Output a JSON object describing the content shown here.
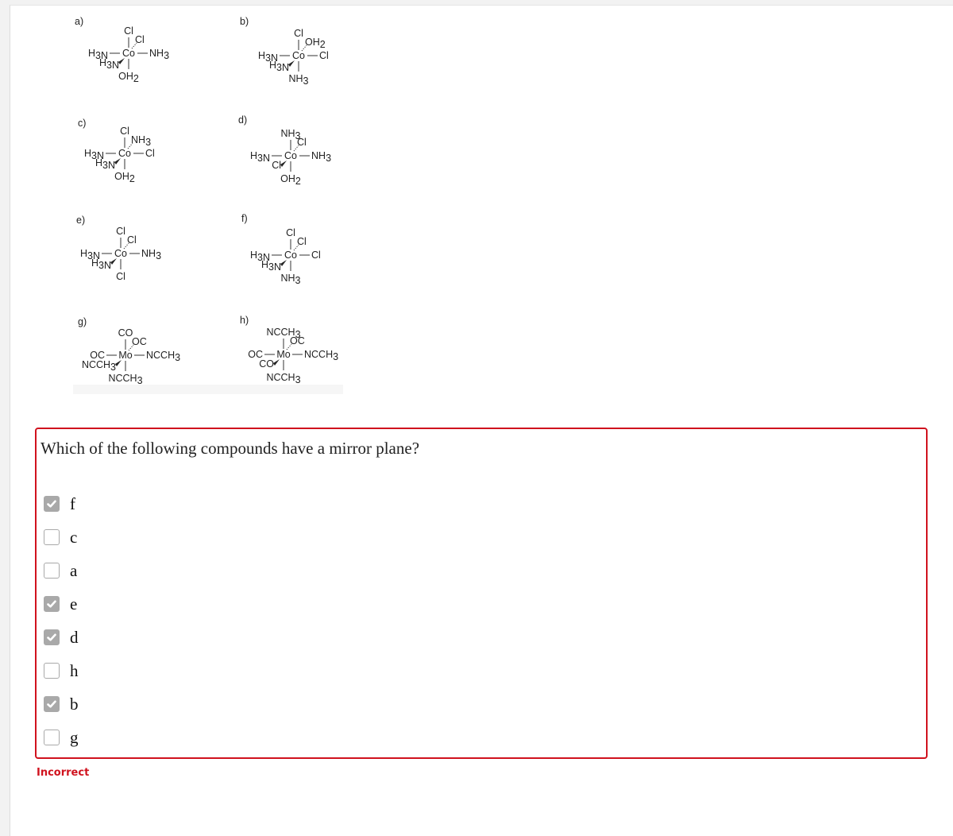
{
  "structures": [
    {
      "id": "a",
      "label": "a)",
      "metal": "Co",
      "top": "Cl",
      "bottom": "OH2",
      "left": "H3N",
      "right": "NH3",
      "back": "Cl",
      "front": "H3N"
    },
    {
      "id": "b",
      "label": "b)",
      "metal": "Co",
      "top": "Cl",
      "bottom": "NH3",
      "left": "H3N",
      "right": "Cl",
      "back": "OH2",
      "front": "H3N"
    },
    {
      "id": "c",
      "label": "c)",
      "metal": "Co",
      "top": "Cl",
      "bottom": "OH2",
      "left": "H3N",
      "right": "Cl",
      "back": "NH3",
      "front": "H3N"
    },
    {
      "id": "d",
      "label": "d)",
      "metal": "Co",
      "top": "NH3",
      "bottom": "OH2",
      "left": "H3N",
      "right": "NH3",
      "back": "Cl",
      "front": "Cl"
    },
    {
      "id": "e",
      "label": "e)",
      "metal": "Co",
      "top": "Cl",
      "bottom": "Cl",
      "left": "H3N",
      "right": "NH3",
      "back": "Cl",
      "front": "H3N"
    },
    {
      "id": "f",
      "label": "f)",
      "metal": "Co",
      "top": "Cl",
      "bottom": "NH3",
      "left": "H3N",
      "right": "Cl",
      "back": "Cl",
      "front": "H3N"
    },
    {
      "id": "g",
      "label": "g)",
      "metal": "Mo",
      "top": "CO",
      "bottom": "NCCH3",
      "left": "OC",
      "right": "NCCH3",
      "back": "OC",
      "front": "NCCH3"
    },
    {
      "id": "h",
      "label": "h)",
      "metal": "Mo",
      "top": "NCCH3",
      "bottom": "NCCH3",
      "left": "OC",
      "right": "NCCH3",
      "back": "OC",
      "front": "CO"
    }
  ],
  "question": {
    "text": "Which of the following compounds have a mirror plane?",
    "options": [
      {
        "label": "f",
        "checked": true
      },
      {
        "label": "c",
        "checked": false
      },
      {
        "label": "a",
        "checked": false
      },
      {
        "label": "e",
        "checked": true
      },
      {
        "label": "d",
        "checked": true
      },
      {
        "label": "h",
        "checked": false
      },
      {
        "label": "b",
        "checked": true
      },
      {
        "label": "g",
        "checked": false
      }
    ],
    "status": "Incorrect"
  },
  "colors": {
    "error": "#d0121e",
    "checkbox_checked": "#a9a9a9"
  }
}
